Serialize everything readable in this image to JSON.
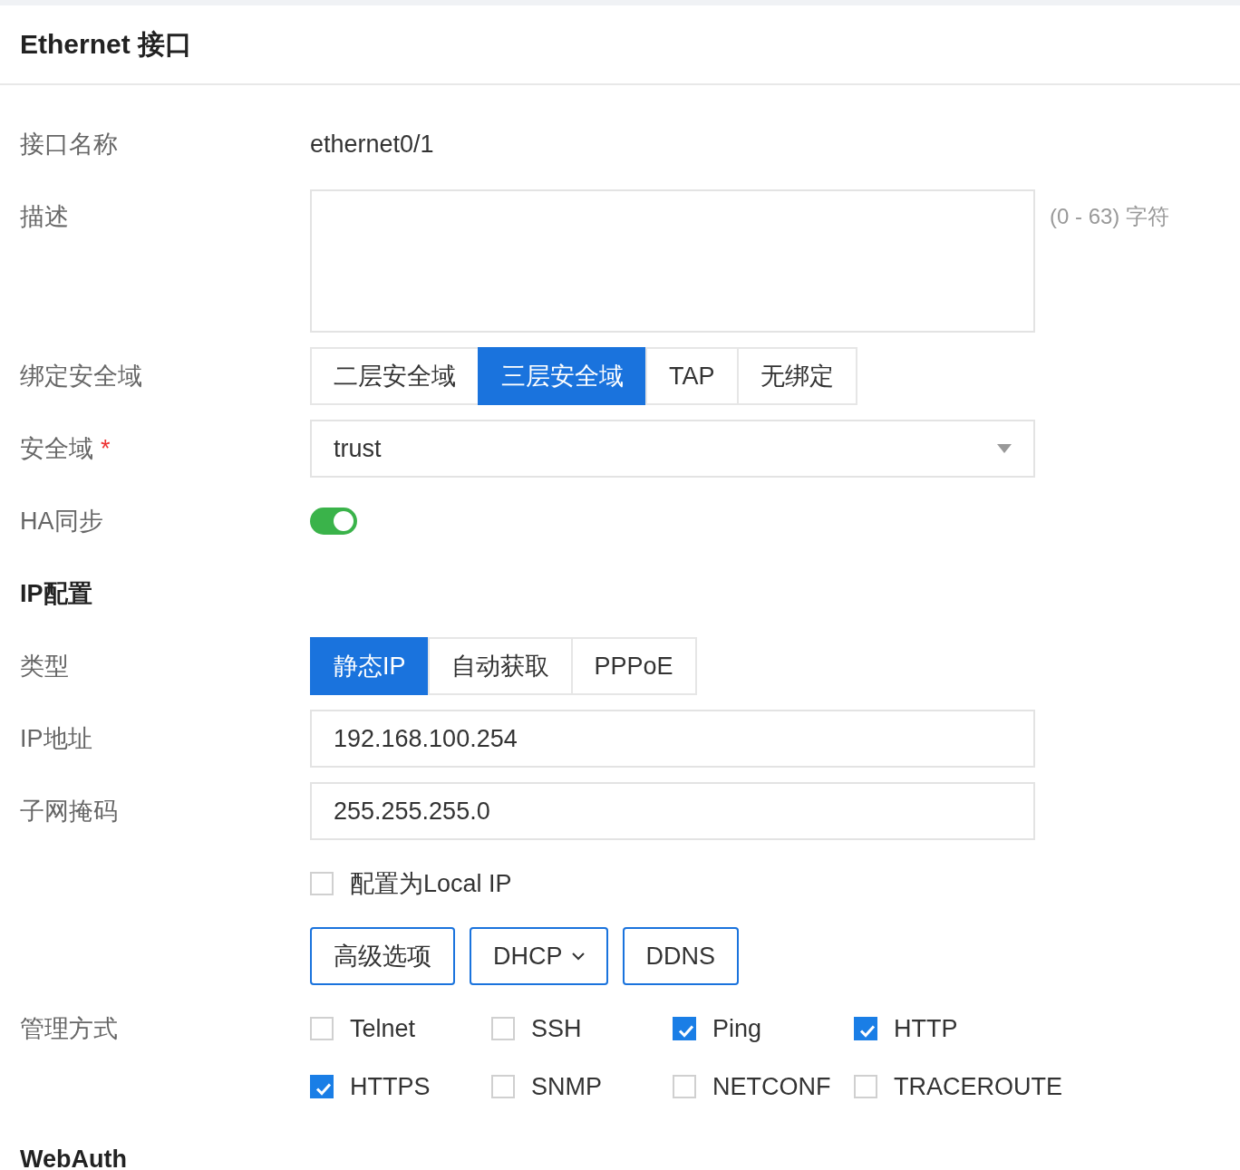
{
  "header": {
    "title": "Ethernet 接口"
  },
  "rows": [
    {
      "kind": "text",
      "label": "接口名称",
      "value": "ethernet0/1"
    },
    {
      "kind": "textarea",
      "label": "描述",
      "hint": "(0 - 63) 字符"
    },
    {
      "kind": "segmented",
      "label": "绑定安全域",
      "options": [
        {
          "label": "二层安全域",
          "selected": false
        },
        {
          "label": "三层安全域",
          "selected": true
        },
        {
          "label": "TAP",
          "selected": false
        },
        {
          "label": "无绑定",
          "selected": false
        }
      ]
    },
    {
      "kind": "select",
      "label": "安全域",
      "required_mark": "*",
      "value": "trust"
    },
    {
      "kind": "toggle",
      "label": "HA同步",
      "on": true
    },
    {
      "kind": "section",
      "label": "IP配置"
    },
    {
      "kind": "segmented",
      "label": "类型",
      "options": [
        {
          "label": "静态IP",
          "selected": true
        },
        {
          "label": "自动获取",
          "selected": false
        },
        {
          "label": "PPPoE",
          "selected": false
        }
      ]
    },
    {
      "kind": "input",
      "label": "IP地址",
      "value": "192.168.100.254"
    },
    {
      "kind": "input",
      "label": "子网掩码",
      "value": "255.255.255.0"
    },
    {
      "kind": "checkbox",
      "text": "配置为Local IP",
      "checked": false
    },
    {
      "kind": "buttons",
      "buttons": [
        {
          "label": "高级选项",
          "dropdown": false
        },
        {
          "label": "DHCP",
          "dropdown": true
        },
        {
          "label": "DDNS",
          "dropdown": false
        }
      ]
    },
    {
      "kind": "checkgrid",
      "label": "管理方式",
      "options": [
        {
          "label": "Telnet",
          "checked": false
        },
        {
          "label": "SSH",
          "checked": false
        },
        {
          "label": "Ping",
          "checked": true
        },
        {
          "label": "HTTP",
          "checked": true
        },
        {
          "label": "HTTPS",
          "checked": true
        },
        {
          "label": "SNMP",
          "checked": false
        },
        {
          "label": "NETCONF",
          "checked": false
        },
        {
          "label": "TRACEROUTE",
          "checked": false
        }
      ]
    },
    {
      "kind": "section",
      "label": "WebAuth"
    }
  ]
}
